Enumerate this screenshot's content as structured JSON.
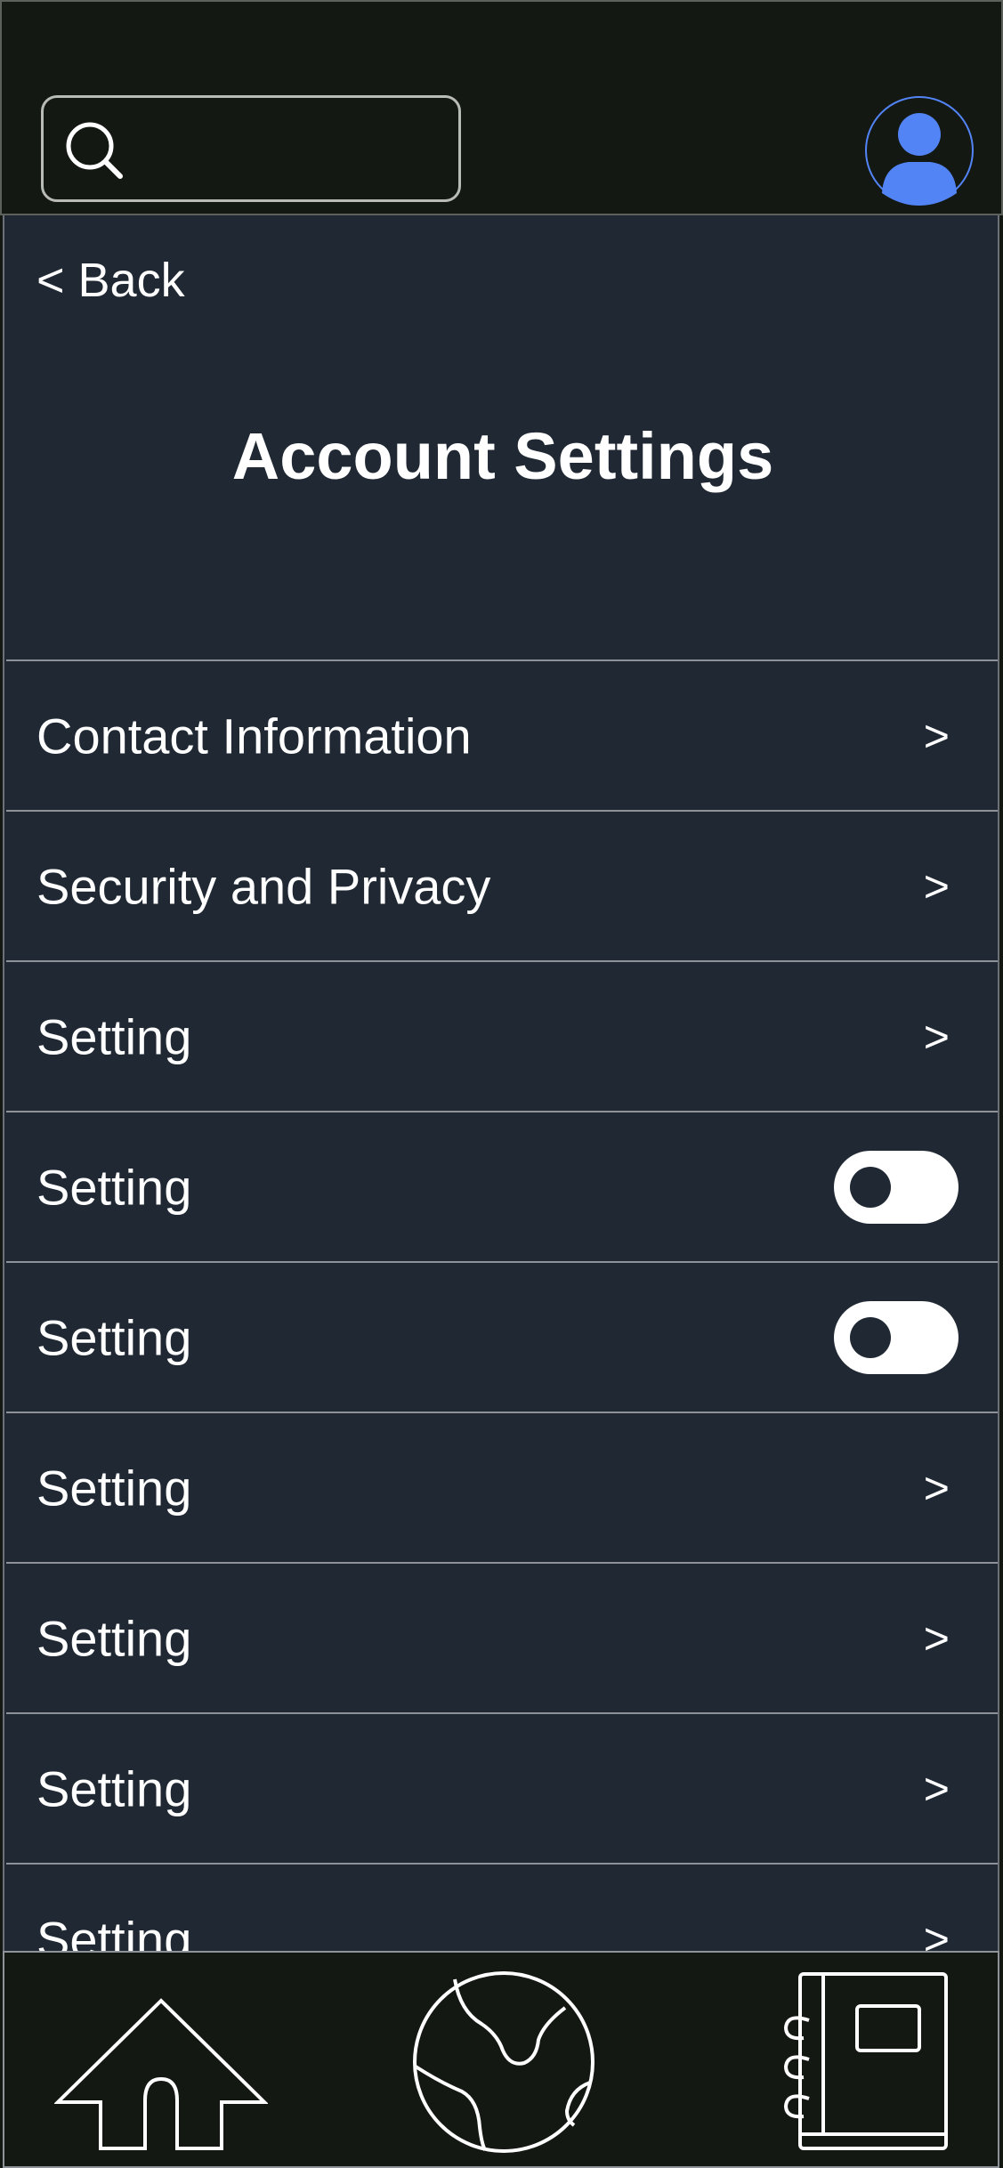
{
  "header": {
    "search": {
      "placeholder": "",
      "icon": "search-icon"
    },
    "avatar": {
      "icon": "user-avatar-icon",
      "color": "#5384f6"
    }
  },
  "page": {
    "back_label": "< Back",
    "title": "Account Settings"
  },
  "settings": [
    {
      "label": "Contact Information",
      "control": "chevron",
      "chevron": ">"
    },
    {
      "label": "Security and Privacy",
      "control": "chevron",
      "chevron": ">"
    },
    {
      "label": "Setting",
      "control": "chevron",
      "chevron": ">"
    },
    {
      "label": "Setting",
      "control": "toggle",
      "state": "off"
    },
    {
      "label": "Setting",
      "control": "toggle",
      "state": "off"
    },
    {
      "label": "Setting",
      "control": "chevron",
      "chevron": ">"
    },
    {
      "label": "Setting",
      "control": "chevron",
      "chevron": ">"
    },
    {
      "label": "Setting",
      "control": "chevron",
      "chevron": ">"
    },
    {
      "label": "Setting",
      "control": "chevron",
      "chevron": ">"
    }
  ],
  "bottom_nav": [
    {
      "icon": "home-icon"
    },
    {
      "icon": "globe-icon"
    },
    {
      "icon": "notebook-icon"
    }
  ],
  "colors": {
    "header_bg": "#141813",
    "content_bg": "#1f2833",
    "accent": "#5384f6",
    "text": "#ffffff"
  }
}
